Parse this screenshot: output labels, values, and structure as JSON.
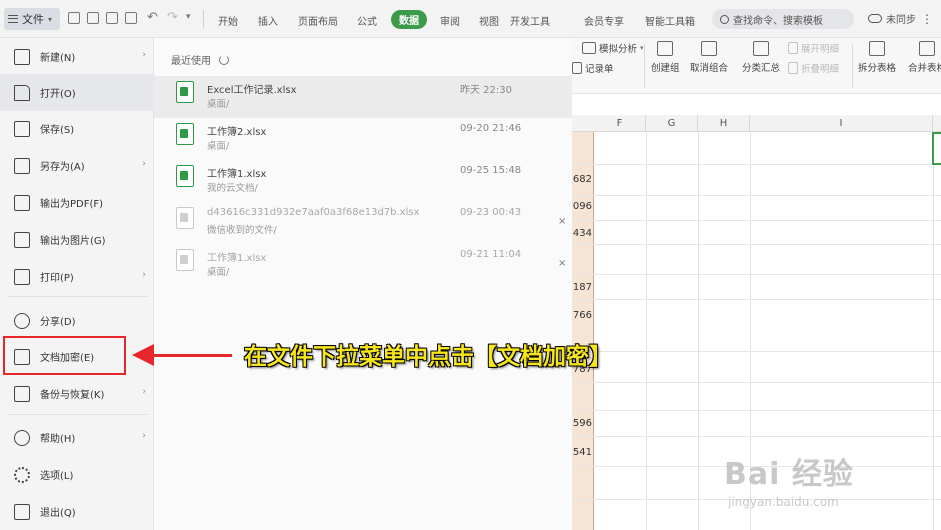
{
  "toolbar": {
    "file_label": "文件",
    "tabs": [
      "开始",
      "插入",
      "页面布局",
      "公式",
      "数据",
      "审阅",
      "视图",
      "开发工具",
      "会员专享",
      "智能工具箱"
    ],
    "active_tab": "数据",
    "search_placeholder": "查找命令、搜索模板",
    "cloud_label": "未同步",
    "more": "⋮"
  },
  "ribbon": {
    "pivot_analysis": "模拟分析",
    "record_sheet": "记录单",
    "create_group": "创建组",
    "ungroup": "取消组合",
    "subtotal": "分类汇总",
    "expand_detail": "展开明细",
    "collapse_detail": "折叠明细",
    "split_table": "拆分表格",
    "merge_table": "合并表格"
  },
  "grid": {
    "columns": [
      "F",
      "G",
      "H",
      "I"
    ],
    "cells": [
      "682",
      "096",
      "434",
      "187",
      "766",
      "787",
      "596",
      "541"
    ]
  },
  "file_menu": {
    "items": [
      {
        "label": "新建(N)",
        "has_submenu": true
      },
      {
        "label": "打开(O)",
        "has_submenu": false
      },
      {
        "label": "保存(S)",
        "has_submenu": false
      },
      {
        "label": "另存为(A)",
        "has_submenu": true
      },
      {
        "label": "输出为PDF(F)",
        "has_submenu": false
      },
      {
        "label": "输出为图片(G)",
        "has_submenu": false
      },
      {
        "label": "打印(P)",
        "has_submenu": true
      },
      {
        "label": "分享(D)",
        "has_submenu": false
      },
      {
        "label": "文档加密(E)",
        "has_submenu": true
      },
      {
        "label": "备份与恢复(K)",
        "has_submenu": true
      },
      {
        "label": "帮助(H)",
        "has_submenu": true
      },
      {
        "label": "选项(L)",
        "has_submenu": false
      },
      {
        "label": "退出(Q)",
        "has_submenu": false
      }
    ]
  },
  "recent": {
    "title": "最近使用",
    "files": [
      {
        "name": "Excel工作记录.xlsx",
        "path": "桌面/",
        "time": "昨天 22:30",
        "available": true
      },
      {
        "name": "工作簿2.xlsx",
        "path": "桌面/",
        "time": "09-20 21:46",
        "available": true
      },
      {
        "name": "工作簿1.xlsx",
        "path": "我的云文档/",
        "time": "09-25 15:48",
        "available": true
      },
      {
        "name": "d43616c331d932e7aaf0a3f68e13d7b.xlsx",
        "path": "微信收到的文件/",
        "time": "09-23 00:43",
        "available": false
      },
      {
        "name": "工作簿1.xlsx",
        "path": "桌面/",
        "time": "09-21 11:04",
        "available": false
      }
    ],
    "close_symbol": "×"
  },
  "annotation": {
    "text": "在文件下拉菜单中点击【文档加密】"
  },
  "watermark": {
    "brand": "Bai 经验",
    "url": "jingyan.baidu.com"
  },
  "colors": {
    "accent_green": "#3c9a4b",
    "highlight_red": "#e6262b",
    "annotation_yellow": "#f6e51a"
  }
}
